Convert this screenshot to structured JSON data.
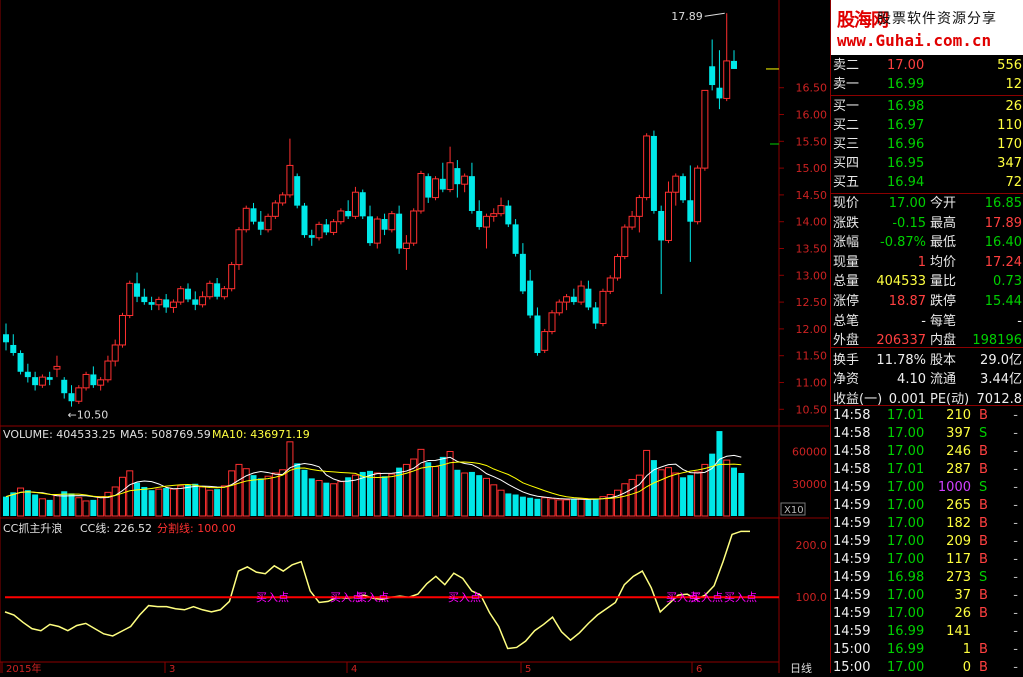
{
  "chart": {
    "price_axis_labels": [
      "16.50",
      "16.00",
      "15.50",
      "15.00",
      "14.50",
      "14.00",
      "13.50",
      "13.00",
      "12.50",
      "12.00",
      "11.50",
      "11.00",
      "10.50"
    ],
    "high_marker": "17.89",
    "low_marker": "10.50",
    "volume_header": {
      "label": "VOLUME: 404533.25",
      "ma5": "MA5: 508769.59",
      "ma10": "MA10: 436971.19"
    },
    "volume_axis_labels": [
      "60000",
      "30000"
    ],
    "volume_multiplier": "X10",
    "indicator_header": {
      "name": "CC抓主升浪",
      "cc_line": "CC线: 226.52",
      "split_line": "分割线: 100.00"
    },
    "indicator_axis_labels": [
      "200.0",
      "100.0"
    ],
    "signal_labels": [
      "买入点",
      "买入点",
      "买入点",
      "买入点",
      "买入点",
      "买入点",
      "买入点"
    ],
    "bottom_labels": [
      "2015年",
      "3",
      "4",
      "5",
      "6"
    ],
    "period_label": "日线",
    "colors": {
      "up": "#ff3030",
      "down": "#00e8e8",
      "ma_white": "#ffffff",
      "ma_yellow": "#ffff00",
      "cc_line": "#ffff80",
      "split": "#ff0000",
      "signal": "#ff00ff"
    }
  },
  "chart_data": [
    {
      "type": "candlestick",
      "title": "",
      "ylim": [
        10.3,
        17.95
      ],
      "candles": [
        [
          11.9,
          12.1,
          11.6,
          11.75
        ],
        [
          11.7,
          11.9,
          11.5,
          11.55
        ],
        [
          11.55,
          11.6,
          11.15,
          11.2
        ],
        [
          11.2,
          11.35,
          11.0,
          11.1
        ],
        [
          11.1,
          11.2,
          10.85,
          10.95
        ],
        [
          10.95,
          11.15,
          10.9,
          11.1
        ],
        [
          11.1,
          11.2,
          10.95,
          11.05
        ],
        [
          11.25,
          11.5,
          11.1,
          11.3
        ],
        [
          11.05,
          11.1,
          10.7,
          10.8
        ],
        [
          10.8,
          10.95,
          10.55,
          10.65
        ],
        [
          10.65,
          10.95,
          10.6,
          10.9
        ],
        [
          10.9,
          11.2,
          10.85,
          11.15
        ],
        [
          11.15,
          11.3,
          10.9,
          10.95
        ],
        [
          10.95,
          11.1,
          10.85,
          11.05
        ],
        [
          11.05,
          11.5,
          11.0,
          11.4
        ],
        [
          11.4,
          11.8,
          11.3,
          11.7
        ],
        [
          11.7,
          12.3,
          11.65,
          12.25
        ],
        [
          12.25,
          12.9,
          12.2,
          12.85
        ],
        [
          12.85,
          13.05,
          12.5,
          12.6
        ],
        [
          12.6,
          12.75,
          12.45,
          12.5
        ],
        [
          12.5,
          12.6,
          12.35,
          12.45
        ],
        [
          12.45,
          12.6,
          12.35,
          12.55
        ],
        [
          12.55,
          12.65,
          12.3,
          12.4
        ],
        [
          12.4,
          12.55,
          12.3,
          12.5
        ],
        [
          12.5,
          12.8,
          12.45,
          12.75
        ],
        [
          12.75,
          12.85,
          12.5,
          12.55
        ],
        [
          12.55,
          12.7,
          12.35,
          12.45
        ],
        [
          12.45,
          12.7,
          12.4,
          12.6
        ],
        [
          12.6,
          12.9,
          12.55,
          12.85
        ],
        [
          12.85,
          12.95,
          12.55,
          12.6
        ],
        [
          12.6,
          12.8,
          12.55,
          12.75
        ],
        [
          12.75,
          13.25,
          12.7,
          13.2
        ],
        [
          13.2,
          13.9,
          13.1,
          13.85
        ],
        [
          13.85,
          14.3,
          13.8,
          14.25
        ],
        [
          14.25,
          14.35,
          13.95,
          14.0
        ],
        [
          14.0,
          14.2,
          13.75,
          13.85
        ],
        [
          13.85,
          14.15,
          13.8,
          14.1
        ],
        [
          14.1,
          14.4,
          14.05,
          14.35
        ],
        [
          14.35,
          14.55,
          14.3,
          14.5
        ],
        [
          14.5,
          15.55,
          14.45,
          15.05
        ],
        [
          14.85,
          14.9,
          14.25,
          14.3
        ],
        [
          14.3,
          14.35,
          13.7,
          13.75
        ],
        [
          13.75,
          13.85,
          13.55,
          13.7
        ],
        [
          13.7,
          14.0,
          13.65,
          13.95
        ],
        [
          13.95,
          14.05,
          13.75,
          13.8
        ],
        [
          13.8,
          14.05,
          13.75,
          14.0
        ],
        [
          14.0,
          14.25,
          13.95,
          14.2
        ],
        [
          14.2,
          14.4,
          14.05,
          14.1
        ],
        [
          14.1,
          14.65,
          14.05,
          14.55
        ],
        [
          14.55,
          14.6,
          14.05,
          14.1
        ],
        [
          14.1,
          14.3,
          13.55,
          13.6
        ],
        [
          13.6,
          14.1,
          13.5,
          14.05
        ],
        [
          14.05,
          14.15,
          13.75,
          13.85
        ],
        [
          13.85,
          14.2,
          13.8,
          14.15
        ],
        [
          14.15,
          14.3,
          13.4,
          13.5
        ],
        [
          13.5,
          13.75,
          13.1,
          13.6
        ],
        [
          13.6,
          14.25,
          13.55,
          14.2
        ],
        [
          14.2,
          14.95,
          14.15,
          14.9
        ],
        [
          14.85,
          14.9,
          14.35,
          14.45
        ],
        [
          14.45,
          14.85,
          14.4,
          14.8
        ],
        [
          14.8,
          15.1,
          14.55,
          14.6
        ],
        [
          14.6,
          15.4,
          14.55,
          15.1
        ],
        [
          15.0,
          15.15,
          14.45,
          14.7
        ],
        [
          14.7,
          14.9,
          14.55,
          14.85
        ],
        [
          14.85,
          15.1,
          14.15,
          14.2
        ],
        [
          14.2,
          14.4,
          13.85,
          13.9
        ],
        [
          13.9,
          14.15,
          13.5,
          14.1
        ],
        [
          14.1,
          14.25,
          14.0,
          14.15
        ],
        [
          14.15,
          14.45,
          14.1,
          14.3
        ],
        [
          14.3,
          14.4,
          13.9,
          13.95
        ],
        [
          13.95,
          14.05,
          13.35,
          13.4
        ],
        [
          13.4,
          13.6,
          12.65,
          12.7
        ],
        [
          12.9,
          13.1,
          12.2,
          12.25
        ],
        [
          12.25,
          12.4,
          11.5,
          11.55
        ],
        [
          11.6,
          12.0,
          11.55,
          11.95
        ],
        [
          11.95,
          12.35,
          11.9,
          12.3
        ],
        [
          12.3,
          12.55,
          12.25,
          12.5
        ],
        [
          12.5,
          12.65,
          12.35,
          12.6
        ],
        [
          12.6,
          12.75,
          12.45,
          12.5
        ],
        [
          12.5,
          12.9,
          12.45,
          12.8
        ],
        [
          12.75,
          12.9,
          12.35,
          12.4
        ],
        [
          12.4,
          12.5,
          12.0,
          12.1
        ],
        [
          12.1,
          12.75,
          12.05,
          12.7
        ],
        [
          12.7,
          13.0,
          12.65,
          12.95
        ],
        [
          12.95,
          13.4,
          12.9,
          13.35
        ],
        [
          13.35,
          13.95,
          13.3,
          13.9
        ],
        [
          13.9,
          14.2,
          13.85,
          14.1
        ],
        [
          14.1,
          14.5,
          13.8,
          14.45
        ],
        [
          14.45,
          15.65,
          14.4,
          15.6
        ],
        [
          15.6,
          15.7,
          14.15,
          14.2
        ],
        [
          14.2,
          14.3,
          12.65,
          13.65
        ],
        [
          13.65,
          14.75,
          13.6,
          14.55
        ],
        [
          14.55,
          14.9,
          14.3,
          14.85
        ],
        [
          14.85,
          14.9,
          14.35,
          14.4
        ],
        [
          14.4,
          15.05,
          13.25,
          14.0
        ],
        [
          14.0,
          15.05,
          13.95,
          15.0
        ],
        [
          15.0,
          16.45,
          14.95,
          16.45
        ],
        [
          16.9,
          17.4,
          16.45,
          16.55
        ],
        [
          16.5,
          17.2,
          16.1,
          16.3
        ],
        [
          16.3,
          17.89,
          16.25,
          17.0
        ],
        [
          17.0,
          17.2,
          16.85,
          16.85
        ]
      ],
      "annotations": [
        "17.89",
        "10.50"
      ]
    },
    {
      "type": "bar",
      "title": "VOLUME",
      "ylim": [
        0,
        80000
      ],
      "values": [
        18000,
        22000,
        26000,
        24000,
        20000,
        16000,
        15000,
        19000,
        23000,
        21000,
        17000,
        14000,
        15000,
        18000,
        22000,
        27000,
        36000,
        42000,
        31000,
        27000,
        24000,
        25000,
        26000,
        25000,
        28000,
        29000,
        30000,
        27000,
        24000,
        25000,
        28000,
        42000,
        48000,
        44000,
        38000,
        35000,
        37000,
        40000,
        43000,
        69000,
        49000,
        43000,
        35000,
        33000,
        31000,
        30000,
        32000,
        36000,
        38000,
        41000,
        42000,
        40000,
        37000,
        39000,
        45000,
        48000,
        53000,
        62000,
        50000,
        46000,
        55000,
        60000,
        43000,
        40000,
        41000,
        38000,
        35000,
        29000,
        24000,
        21000,
        20000,
        18000,
        17000,
        16000,
        17000,
        16000,
        15000,
        15000,
        16000,
        16000,
        15000,
        16000,
        18000,
        20000,
        24000,
        30000,
        34000,
        38000,
        61000,
        52000,
        43000,
        45000,
        40000,
        36000,
        38000,
        41000,
        48000,
        58000,
        79000,
        52000,
        45000,
        40000
      ],
      "direction": [
        "d",
        "d",
        "u",
        "d",
        "d",
        "u",
        "d",
        "u",
        "d",
        "d",
        "u",
        "u",
        "d",
        "u",
        "u",
        "u",
        "u",
        "u",
        "d",
        "d",
        "d",
        "u",
        "d",
        "u",
        "u",
        "d",
        "d",
        "u",
        "u",
        "d",
        "u",
        "u",
        "u",
        "u",
        "d",
        "d",
        "u",
        "u",
        "u",
        "u",
        "d",
        "d",
        "d",
        "u",
        "d",
        "u",
        "u",
        "d",
        "u",
        "d",
        "d",
        "u",
        "d",
        "u",
        "d",
        "u",
        "u",
        "u",
        "d",
        "u",
        "d",
        "u",
        "d",
        "u",
        "d",
        "d",
        "u",
        "u",
        "u",
        "d",
        "d",
        "d",
        "d",
        "d",
        "u",
        "u",
        "u",
        "u",
        "d",
        "u",
        "d",
        "d",
        "u",
        "u",
        "u",
        "u",
        "u",
        "u",
        "u",
        "d",
        "u",
        "u",
        "u",
        "d",
        "d",
        "u",
        "u",
        "d",
        "d",
        "u",
        "d",
        "d"
      ],
      "ma5_label": "508769.59",
      "ma10_label": "436971.19"
    },
    {
      "type": "line",
      "title": "CC抓主升浪",
      "ylim": [
        -20,
        240
      ],
      "series": [
        {
          "name": "CC线",
          "values": [
            72,
            66,
            52,
            40,
            36,
            48,
            44,
            36,
            46,
            50,
            40,
            30,
            26,
            35,
            44,
            66,
            84,
            82,
            82,
            78,
            76,
            82,
            76,
            72,
            76,
            92,
            150,
            158,
            148,
            145,
            160,
            150,
            162,
            168,
            112,
            90,
            92,
            100,
            98,
            100,
            104,
            98,
            96,
            100,
            102,
            100,
            106,
            126,
            140,
            124,
            146,
            136,
            112,
            104,
            70,
            44,
            2,
            4,
            16,
            36,
            48,
            62,
            34,
            18,
            32,
            50,
            66,
            78,
            90,
            124,
            140,
            150,
            118,
            72,
            88,
            104,
            106,
            96,
            104,
            122,
            168,
            220,
            226,
            226
          ]
        },
        {
          "name": "分割线",
          "values": [
            100
          ]
        }
      ]
    }
  ],
  "sidebar": {
    "logo": {
      "brand_cn": "股海网",
      "slogan": "股票软件资源分享",
      "url": "www.Guhai.com.cn"
    },
    "orders": [
      {
        "label": "卖二",
        "price": "17.00",
        "vol": "556",
        "price_color": "up"
      },
      {
        "label": "卖一",
        "price": "16.99",
        "vol": "12",
        "price_color": "down"
      },
      {
        "label": "买一",
        "price": "16.98",
        "vol": "26",
        "price_color": "down"
      },
      {
        "label": "买二",
        "price": "16.97",
        "vol": "110",
        "price_color": "down"
      },
      {
        "label": "买三",
        "price": "16.96",
        "vol": "170",
        "price_color": "down"
      },
      {
        "label": "买四",
        "price": "16.95",
        "vol": "347",
        "price_color": "down"
      },
      {
        "label": "买五",
        "price": "16.94",
        "vol": "72",
        "price_color": "down"
      }
    ],
    "stats": [
      {
        "l1": "现价",
        "v1": "17.00",
        "c1": "down",
        "l2": "今开",
        "v2": "16.85",
        "c2": "down"
      },
      {
        "l1": "涨跌",
        "v1": "-0.15",
        "c1": "down",
        "l2": "最高",
        "v2": "17.89",
        "c2": "up"
      },
      {
        "l1": "涨幅",
        "v1": "-0.87%",
        "c1": "down",
        "l2": "最低",
        "v2": "16.40",
        "c2": "down"
      },
      {
        "l1": "现量",
        "v1": "1",
        "c1": "up",
        "l2": "均价",
        "v2": "17.24",
        "c2": "up"
      },
      {
        "l1": "总量",
        "v1": "404533",
        "c1": "yel",
        "l2": "量比",
        "v2": "0.73",
        "c2": "down"
      },
      {
        "l1": "涨停",
        "v1": "18.87",
        "c1": "up",
        "l2": "跌停",
        "v2": "15.44",
        "c2": "down"
      },
      {
        "l1": "总笔",
        "v1": "-",
        "c1": "white",
        "l2": "每笔",
        "v2": "-",
        "c2": "white"
      },
      {
        "l1": "外盘",
        "v1": "206337",
        "c1": "up",
        "l2": "内盘",
        "v2": "198196",
        "c2": "down"
      },
      {
        "l1": "换手",
        "v1": "11.78%",
        "c1": "white",
        "l2": "股本",
        "v2": "29.0亿",
        "c2": "white"
      },
      {
        "l1": "净资",
        "v1": "4.10",
        "c1": "white",
        "l2": "流通",
        "v2": "3.44亿",
        "c2": "white"
      },
      {
        "l1": "收益(一)",
        "v1": "0.001",
        "c1": "white",
        "l2": "PE(动)",
        "v2": "7012.8",
        "c2": "white"
      }
    ],
    "ticks": [
      {
        "time": "14:58",
        "price": "17.01",
        "vol": "210",
        "bs": "B"
      },
      {
        "time": "14:58",
        "price": "17.00",
        "vol": "397",
        "bs": "S"
      },
      {
        "time": "14:58",
        "price": "17.00",
        "vol": "246",
        "bs": "B"
      },
      {
        "time": "14:58",
        "price": "17.01",
        "vol": "287",
        "bs": "B"
      },
      {
        "time": "14:59",
        "price": "17.00",
        "vol": "1000",
        "bs": "S"
      },
      {
        "time": "14:59",
        "price": "17.00",
        "vol": "265",
        "bs": "B"
      },
      {
        "time": "14:59",
        "price": "17.00",
        "vol": "182",
        "bs": "B"
      },
      {
        "time": "14:59",
        "price": "17.00",
        "vol": "209",
        "bs": "B"
      },
      {
        "time": "14:59",
        "price": "17.00",
        "vol": "117",
        "bs": "B"
      },
      {
        "time": "14:59",
        "price": "16.98",
        "vol": "273",
        "bs": "S"
      },
      {
        "time": "14:59",
        "price": "17.00",
        "vol": "37",
        "bs": "B"
      },
      {
        "time": "14:59",
        "price": "17.00",
        "vol": "26",
        "bs": "B"
      },
      {
        "time": "14:59",
        "price": "16.99",
        "vol": "141",
        "bs": ""
      },
      {
        "time": "15:00",
        "price": "16.99",
        "vol": "1",
        "bs": "B"
      },
      {
        "time": "15:00",
        "price": "17.00",
        "vol": "0",
        "bs": "B"
      }
    ],
    "dash": "-"
  }
}
